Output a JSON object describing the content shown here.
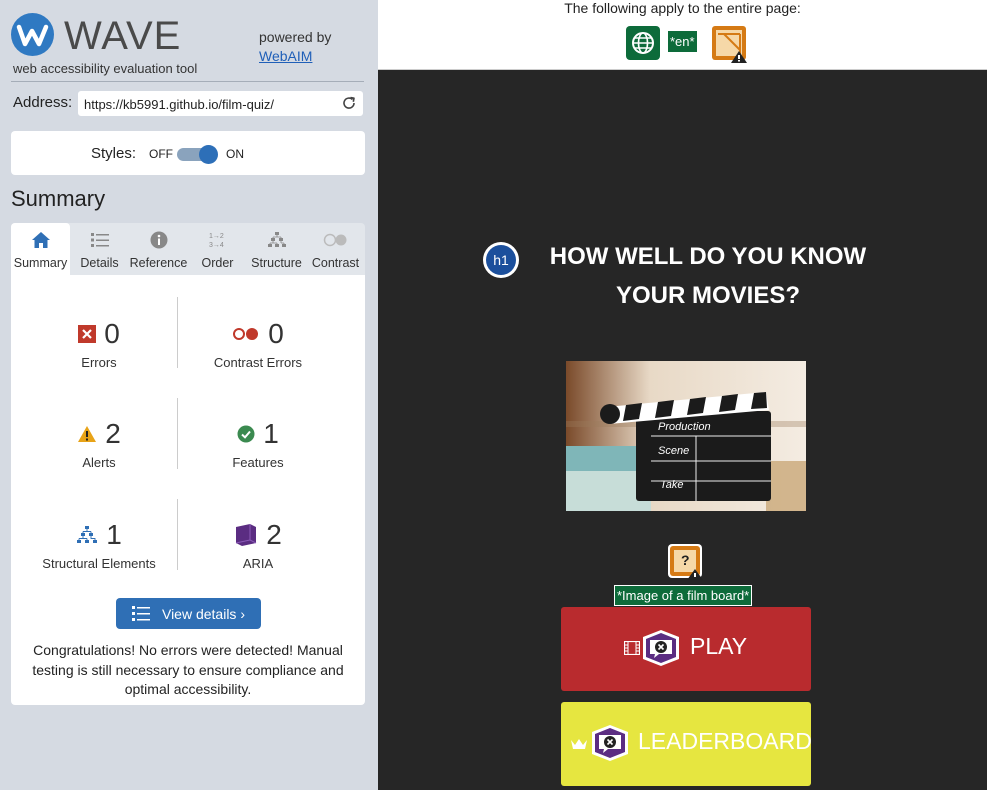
{
  "wave": {
    "logo_word": "WAVE",
    "tagline": "web accessibility evaluation tool",
    "powered_by": "powered by",
    "webaim_link": "WebAIM",
    "address_label": "Address:",
    "address_value": "https://kb5991.github.io/film-quiz/",
    "styles_label": "Styles:",
    "styles_off": "OFF",
    "styles_on": "ON",
    "summary_heading": "Summary",
    "tabs": [
      {
        "label": "Summary",
        "icon": "home-icon",
        "active": true
      },
      {
        "label": "Details",
        "icon": "list-icon"
      },
      {
        "label": "Reference",
        "icon": "info-icon"
      },
      {
        "label": "Order",
        "icon": "order-icon"
      },
      {
        "label": "Structure",
        "icon": "structure-icon"
      },
      {
        "label": "Contrast",
        "icon": "contrast-icon"
      }
    ],
    "stats": {
      "errors": {
        "count": "0",
        "label": "Errors"
      },
      "contrast_errors": {
        "count": "0",
        "label": "Contrast Errors"
      },
      "alerts": {
        "count": "2",
        "label": "Alerts"
      },
      "features": {
        "count": "1",
        "label": "Features"
      },
      "structural": {
        "count": "1",
        "label": "Structural Elements"
      },
      "aria": {
        "count": "2",
        "label": "ARIA"
      }
    },
    "view_details": "View details ›",
    "congrats": "Congratulations! No errors were detected! Manual testing is still necessary to ensure compliance and optimal accessibility."
  },
  "page": {
    "applies_text": "The following apply to the entire page:",
    "lang_badge": "*en*",
    "h1_badge": "h1",
    "title": "HOW WELL DO YOU KNOW YOUR MOVIES?",
    "clapper": {
      "line1": "Production",
      "line2": "Scene",
      "line3": "Take"
    },
    "alt_badge": "?",
    "alt_text": "*Image of a film board*",
    "play_label": "PLAY",
    "leaderboard_label": "LEADERBOARD"
  },
  "colors": {
    "wave_blue": "#2f79c2",
    "error_red": "#c0392b",
    "alert_orange": "#e8a317",
    "feature_green": "#3b8a50",
    "aria_purple": "#5b2d82",
    "play_red": "#b92b2e",
    "leaderboard_yellow": "#e6e640",
    "page_bg": "#262626"
  }
}
